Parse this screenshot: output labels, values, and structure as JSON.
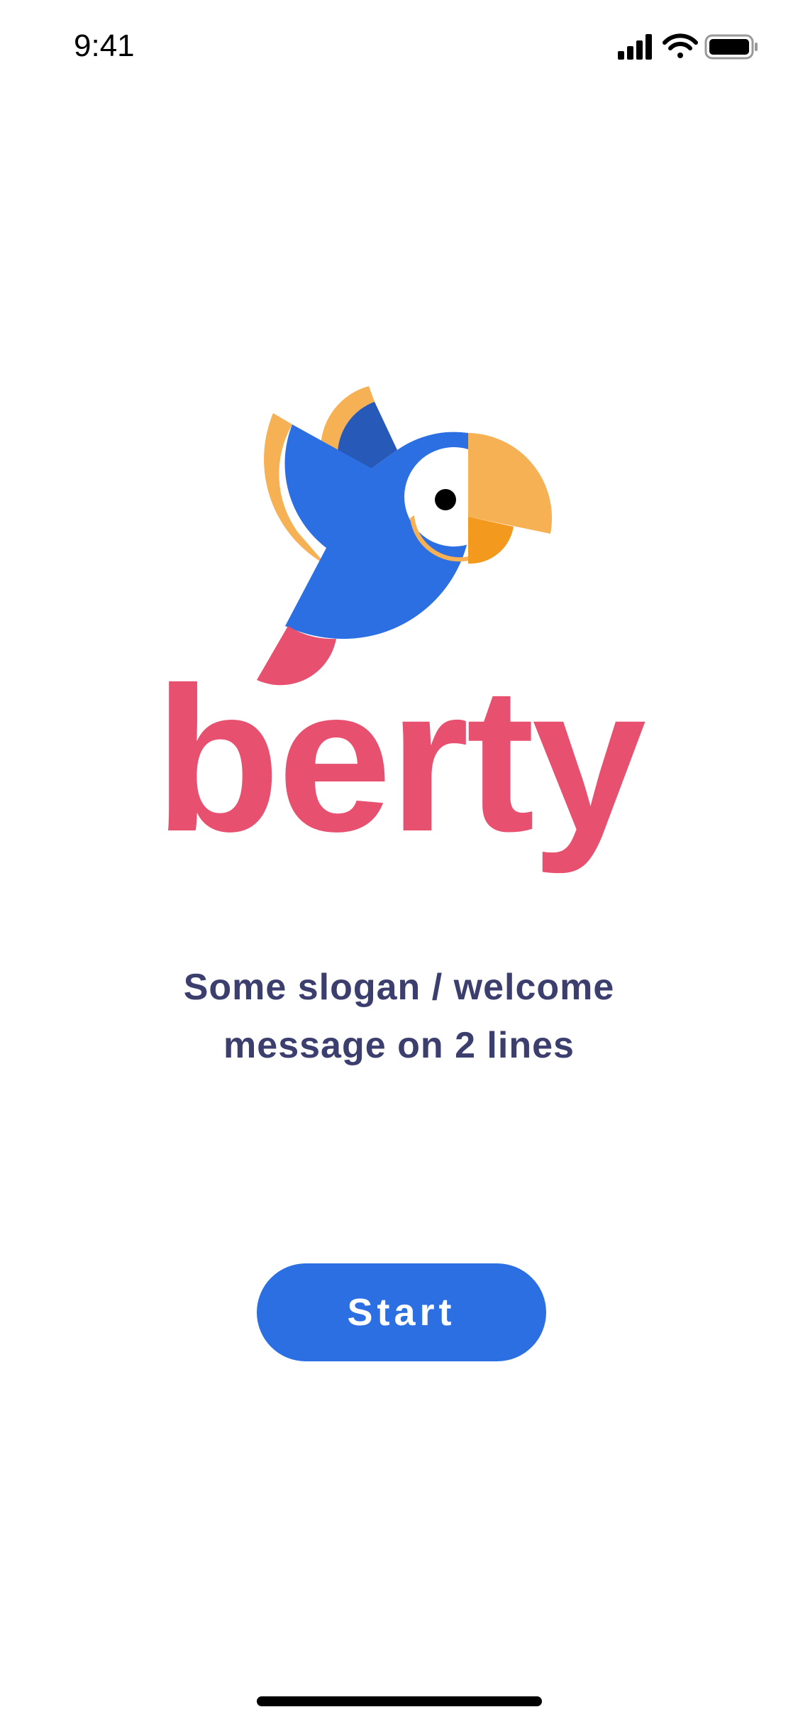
{
  "status_bar": {
    "time": "9:41",
    "icons": [
      "signal-icon",
      "wifi-icon",
      "battery-icon"
    ]
  },
  "brand": {
    "name": "berty",
    "logo": "parrot-logo",
    "colors": {
      "brand_pink": "#E8506F",
      "parrot_blue": "#2C6FE3",
      "parrot_dark_blue": "#2659B8",
      "parrot_yellow": "#F7B155",
      "beak_orange": "#F39A1E"
    }
  },
  "welcome": {
    "line1": "Some slogan / welcome",
    "line2": "message on 2 lines",
    "text_color": "#3C3F6E"
  },
  "actions": {
    "start_label": "Start",
    "button_color": "#2C6FE3"
  }
}
